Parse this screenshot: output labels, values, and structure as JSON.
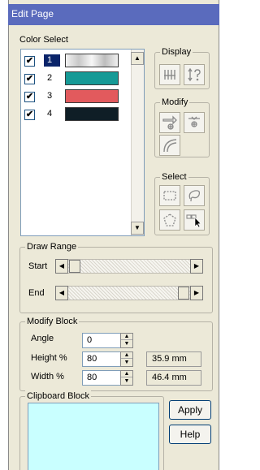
{
  "window": {
    "title": "Edit Page"
  },
  "color_select": {
    "label": "Color Select",
    "items": [
      {
        "number": "1",
        "color": "#e8e8e8",
        "checked": true,
        "selected": true
      },
      {
        "number": "2",
        "color": "#169a96",
        "checked": true,
        "selected": false
      },
      {
        "number": "3",
        "color": "#e25a5d",
        "checked": true,
        "selected": false
      },
      {
        "number": "4",
        "color": "#0f1e26",
        "checked": true,
        "selected": false
      }
    ]
  },
  "display": {
    "label": "Display"
  },
  "modify": {
    "label": "Modify"
  },
  "select": {
    "label": "Select"
  },
  "draw_range": {
    "label": "Draw Range",
    "start_label": "Start",
    "end_label": "End"
  },
  "modify_block": {
    "label": "Modify Block",
    "angle": {
      "label": "Angle",
      "value": "0"
    },
    "height": {
      "label": "Height %",
      "value": "80",
      "readout": "35.9 mm"
    },
    "width": {
      "label": "Width %",
      "value": "80",
      "readout": "46.4 mm"
    }
  },
  "clipboard_block": {
    "label": "Clipboard Block"
  },
  "buttons": {
    "apply": "Apply",
    "help": "Help"
  }
}
